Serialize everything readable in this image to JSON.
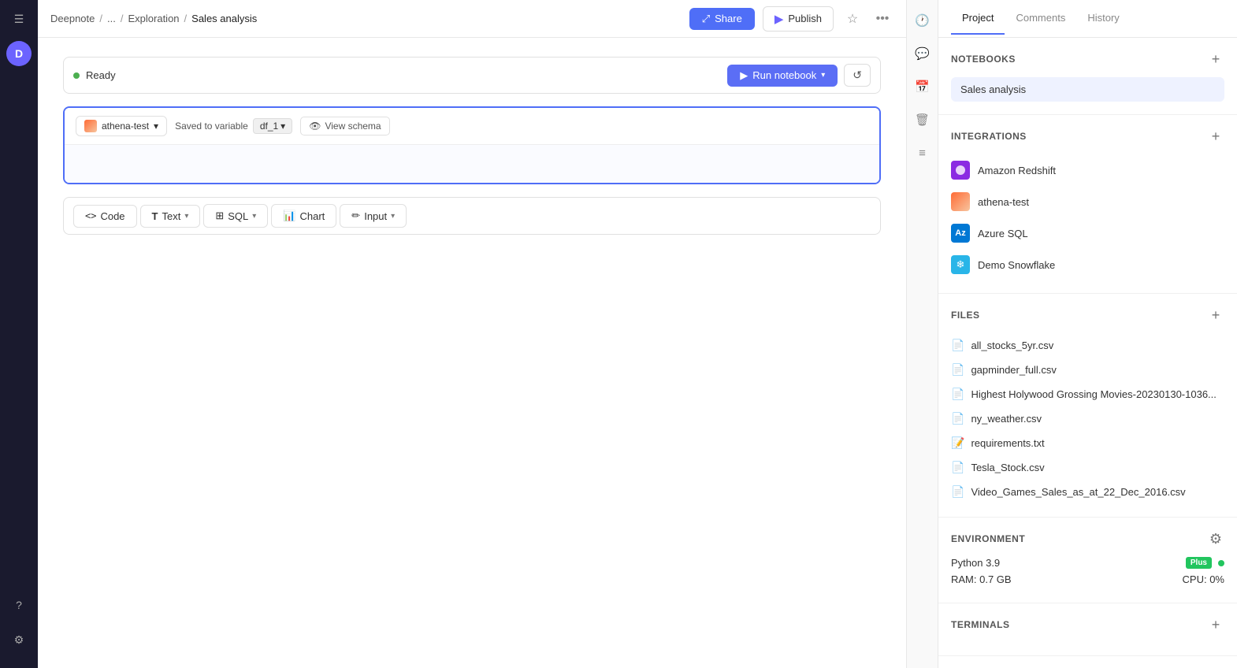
{
  "topbar": {
    "breadcrumb": {
      "root": "Deepnote",
      "sep1": "/",
      "more": "...",
      "sep2": "/",
      "exploration": "Exploration",
      "sep3": "/",
      "current": "Sales analysis"
    },
    "share_label": "Share",
    "publish_label": "Publish"
  },
  "notebook": {
    "status": "Ready",
    "run_label": "Run notebook",
    "cell": {
      "source": "athena-test",
      "saved_to": "Saved to variable",
      "variable": "df_1",
      "view_schema": "View schema"
    },
    "toolbar": {
      "code": "Code",
      "text": "Text",
      "sql": "SQL",
      "chart": "Chart",
      "input": "Input"
    }
  },
  "right_panel": {
    "tabs": [
      "Project",
      "Comments",
      "History"
    ],
    "active_tab": "Project",
    "notebooks_section": "NOTEBOOKS",
    "active_notebook": "Sales analysis",
    "integrations_section": "INTEGRATIONS",
    "integrations": [
      {
        "name": "Amazon Redshift",
        "type": "redshift"
      },
      {
        "name": "athena-test",
        "type": "athena"
      },
      {
        "name": "Azure SQL",
        "type": "azure"
      },
      {
        "name": "Demo Snowflake",
        "type": "snowflake"
      }
    ],
    "files_section": "FILES",
    "files": [
      "all_stocks_5yr.csv",
      "gapminder_full.csv",
      "Highest Holywood Grossing Movies-20230130-1036...",
      "ny_weather.csv",
      "requirements.txt",
      "Tesla_Stock.csv",
      "Video_Games_Sales_as_at_22_Dec_2016.csv"
    ],
    "environment_section": "ENVIRONMENT",
    "python_version": "Python 3.9",
    "plus_label": "Plus",
    "ram_info": "RAM: 0.7 GB",
    "cpu_info": "CPU: 0%",
    "terminals_section": "TERMINALS"
  },
  "icons": {
    "hamburger": "☰",
    "share_icon": "⤢",
    "publish_icon": "▶",
    "star_icon": "☆",
    "more_icon": "···",
    "clock_icon": "🕐",
    "comment_icon": "💬",
    "calendar_icon": "📅",
    "trash_icon": "🗑",
    "list_icon": "≡",
    "refresh_icon": "↺",
    "eye_icon": "👁",
    "chevron_down": "▾",
    "code_icon": "<>",
    "text_icon": "T",
    "sql_icon": "⊞",
    "chart_icon": "📊",
    "pencil_icon": "✏",
    "gear_icon": "⚙",
    "plus_icon": "+",
    "file_icon": "📄",
    "txt_icon": "📝",
    "help_icon": "?",
    "settings_icon": "⚙"
  }
}
